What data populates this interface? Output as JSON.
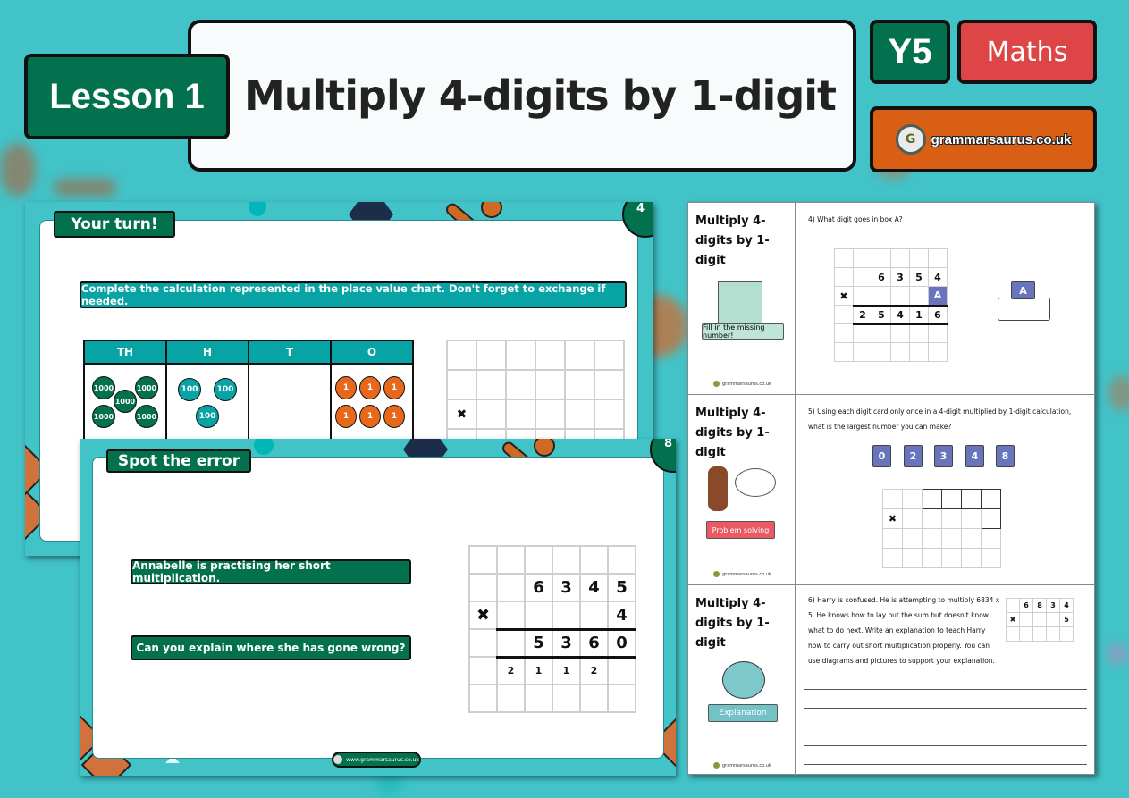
{
  "header": {
    "lesson": "Lesson 1",
    "title": "Multiply 4-digits by 1-digit",
    "year": "Y5",
    "subject": "Maths",
    "brand": "grammarsaurus.co.uk",
    "brand_logo_letter": "G"
  },
  "colors": {
    "background": "#41c3c8",
    "green": "#03714d",
    "teal": "#08a3a4",
    "red": "#dd4546",
    "orange": "#d85f13",
    "card_purple": "#6874bc"
  },
  "slide1": {
    "title": "Your turn!",
    "number": "4",
    "instruction": "Complete the calculation represented in the place value chart. Don't forget to exchange if needed.",
    "table_headers": [
      "TH",
      "H",
      "T",
      "O"
    ],
    "counters": {
      "thousands": [
        "1000",
        "1000",
        "1000",
        "1000",
        "1000"
      ],
      "hundreds": [
        "100",
        "100",
        "100"
      ],
      "ones": [
        "1",
        "1",
        "1",
        "1",
        "1",
        "1"
      ]
    },
    "grid_multiply_symbol": "✖"
  },
  "slide2": {
    "title": "Spot the error",
    "number": "8",
    "statement": "Annabelle is practising her short multiplication.",
    "question": "Can you explain where she has gone wrong?",
    "grid": [
      [
        "",
        "",
        "",
        "",
        "",
        ""
      ],
      [
        "",
        "",
        "6",
        "3",
        "4",
        "5"
      ],
      [
        "✖",
        "",
        "",
        "",
        "",
        "4"
      ],
      [
        "",
        "",
        "5",
        "3",
        "6",
        "0"
      ],
      [
        "",
        "2",
        "1",
        "1",
        "2",
        ""
      ],
      [
        "",
        "",
        "",
        "",
        "",
        ""
      ]
    ],
    "footer": "www.grammarsaurus.co.uk"
  },
  "worksheet": {
    "footer": "grammarsaurus.co.uk",
    "sections": [
      {
        "heading": "Multiply 4-digits by 1-digit",
        "tag": "Fill in the missing number!",
        "question": "4) What digit goes in box A?",
        "grid": [
          [
            "",
            "",
            "",
            "",
            "",
            ""
          ],
          [
            "",
            "",
            "6",
            "3",
            "5",
            "4"
          ],
          [
            "✖",
            "",
            "",
            "",
            "",
            "A"
          ],
          [
            "",
            "2",
            "5",
            "4",
            "1",
            "6"
          ],
          [
            "",
            "",
            "",
            "",
            "",
            ""
          ],
          [
            "",
            "",
            "",
            "",
            "",
            ""
          ]
        ],
        "answer_label": "A"
      },
      {
        "heading": "Multiply 4-digits by 1-digit",
        "tag": "Problem solving",
        "question": "5) Using each digit card only once in a 4-digit multiplied by 1-digit calculation, what is the largest number you can make?",
        "digit_cards": [
          "0",
          "2",
          "3",
          "4",
          "8"
        ],
        "grid_multiply_symbol": "✖"
      },
      {
        "heading": "Multiply 4-digits by 1-digit",
        "tag": "Explanation",
        "question": "6) Harry is confused. He is attempting to multiply 6834 x 5. He knows how to lay out the sum but doesn't know what to do next. Write an explanation to teach Harry how to carry out short multiplication properly. You can use diagrams and pictures to support your explanation.",
        "grid": [
          [
            "",
            "6",
            "8",
            "3",
            "4"
          ],
          [
            "✖",
            "",
            "",
            "",
            "5"
          ],
          [
            "",
            "",
            "",
            "",
            ""
          ]
        ]
      }
    ]
  }
}
